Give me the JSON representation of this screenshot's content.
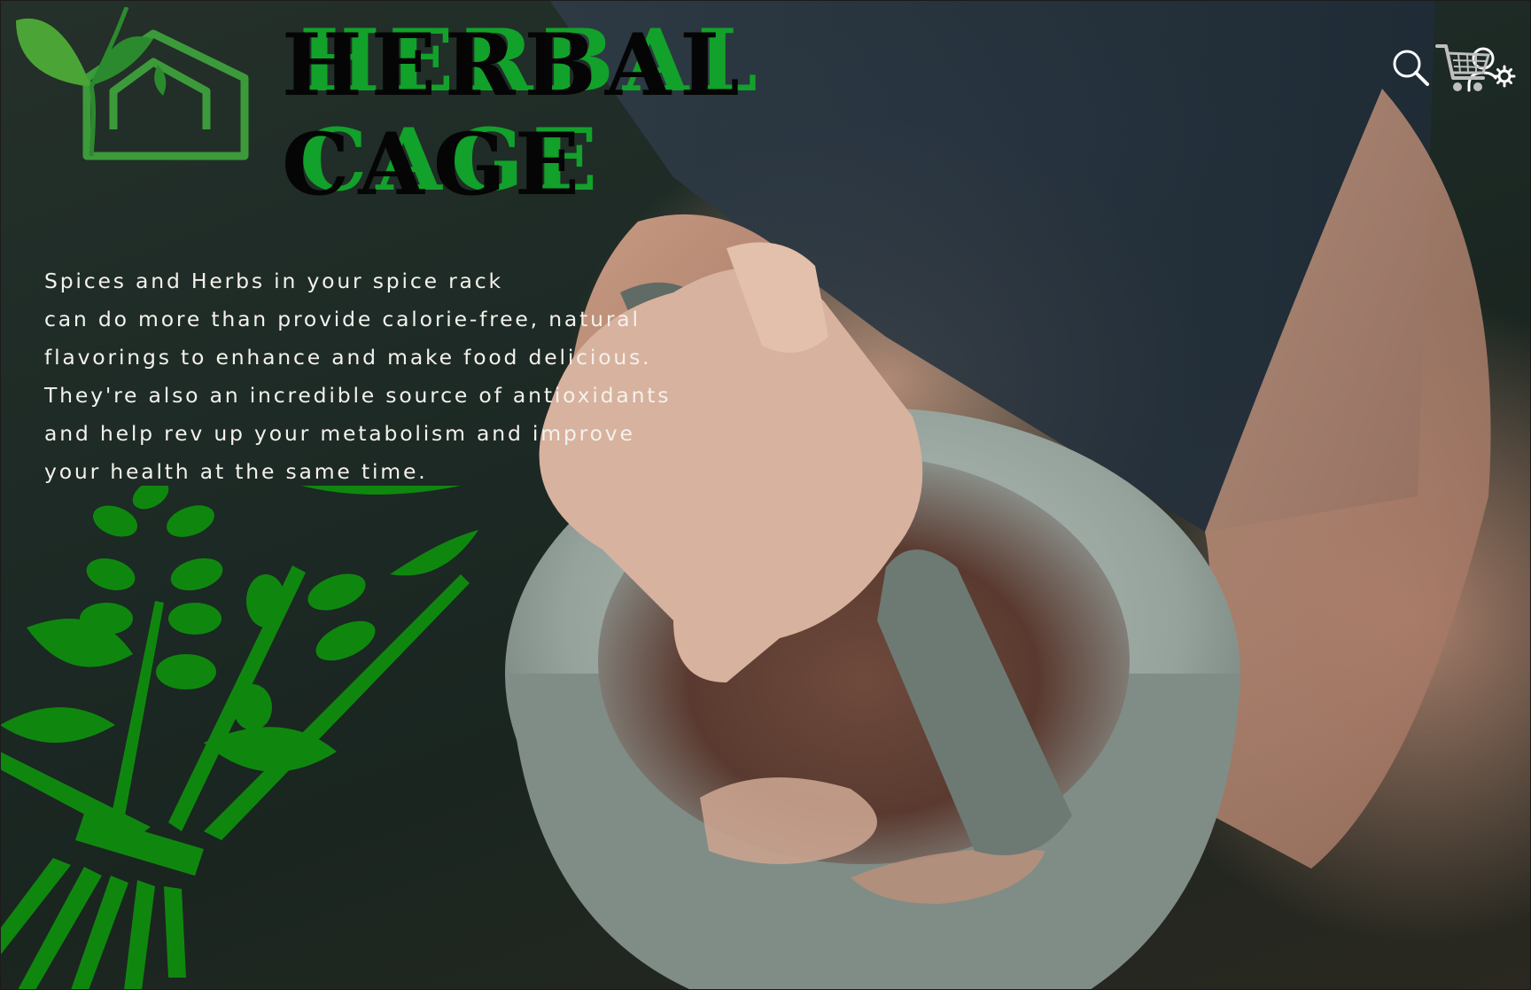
{
  "brand": {
    "line1": "HERBAL",
    "line2": "CAGE"
  },
  "hero": {
    "tagline": "Spices and Herbs in your spice rack\ncan do more than provide calorie-free, natural\nflavorings to enhance and make food delicious.\nThey're also an incredible source of antioxidants\nand help rev up your metabolism and improve\nyour health at the same time."
  },
  "toolbar": {
    "icons": [
      "search-icon",
      "account-settings-icon",
      "cart-icon"
    ]
  },
  "colors": {
    "brand_green": "#12a12a",
    "logo_green": "#3c9a3a",
    "leaf_green": "#0f870f",
    "icon_white": "#ffffff",
    "text": "#f4f1ec"
  }
}
